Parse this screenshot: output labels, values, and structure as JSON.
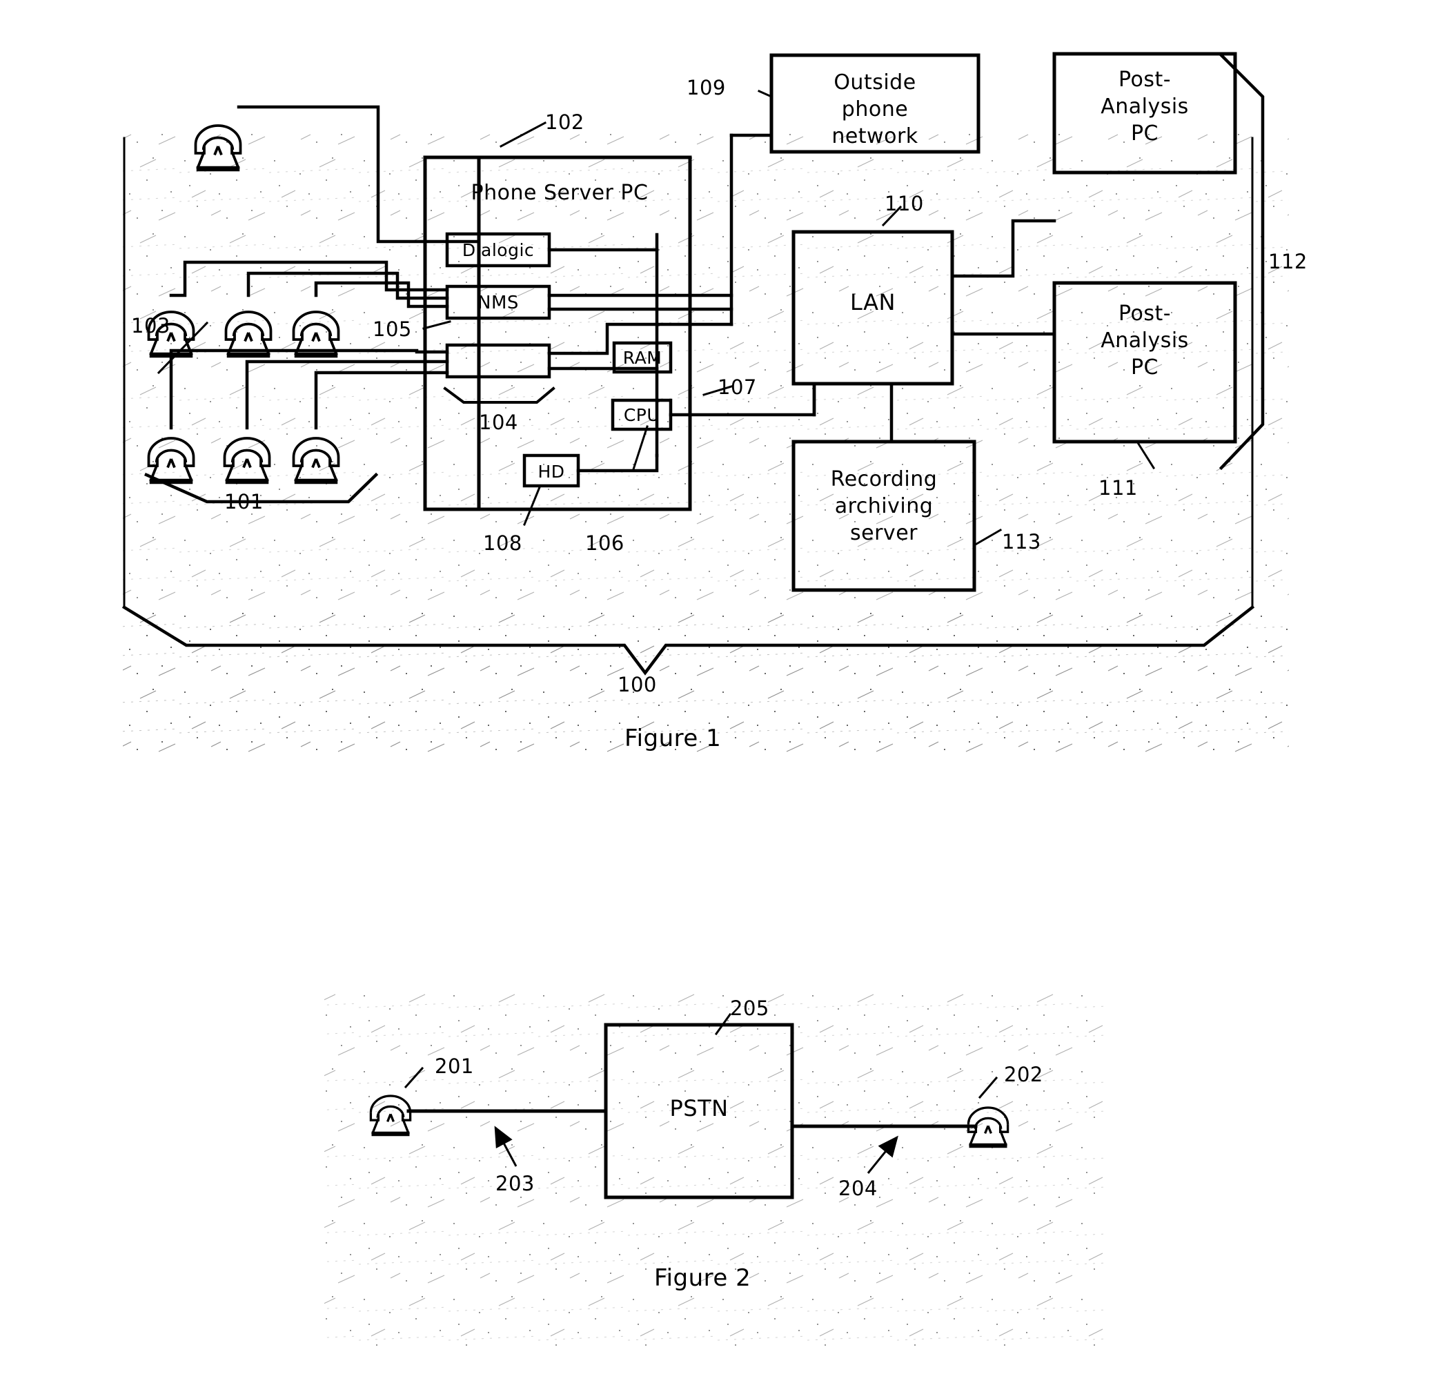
{
  "figure1": {
    "caption": "Figure 1",
    "boxes": {
      "phone_server_pc": "Phone Server PC",
      "dialogic": "Dialogic",
      "nms": "NMS",
      "blank_card": "",
      "ram": "RAM",
      "cpu": "CPU",
      "hd": "HD",
      "outside_phone_network": "Outside\nphone\nnetwork",
      "lan": "LAN",
      "post_analysis_pc_1": "Post-\nAnalysis\nPC",
      "post_analysis_pc_2": "Post-\nAnalysis\nPC",
      "recording_archiving_server": "Recording\narchiving\nserver"
    },
    "reference_numerals": {
      "n100": "100",
      "n101": "101",
      "n102": "102",
      "n103": "103",
      "n104": "104",
      "n105": "105",
      "n106": "106",
      "n107": "107",
      "n108": "108",
      "n109": "109",
      "n110": "110",
      "n111": "111",
      "n112": "112",
      "n113": "113"
    },
    "icons": {
      "phone_top": "telephone-icon",
      "phone_group_mid": "telephone-icon",
      "phone_group_bottom": "telephone-icon"
    }
  },
  "figure2": {
    "caption": "Figure 2",
    "boxes": {
      "pstn": "PSTN"
    },
    "reference_numerals": {
      "n201": "201",
      "n202": "202",
      "n203": "203",
      "n204": "204",
      "n205": "205"
    },
    "icons": {
      "phone_left": "telephone-icon",
      "phone_right": "telephone-icon"
    }
  },
  "colors": {
    "line": "#000000",
    "background": "#ffffff",
    "speckle": "#2b2b2b"
  }
}
